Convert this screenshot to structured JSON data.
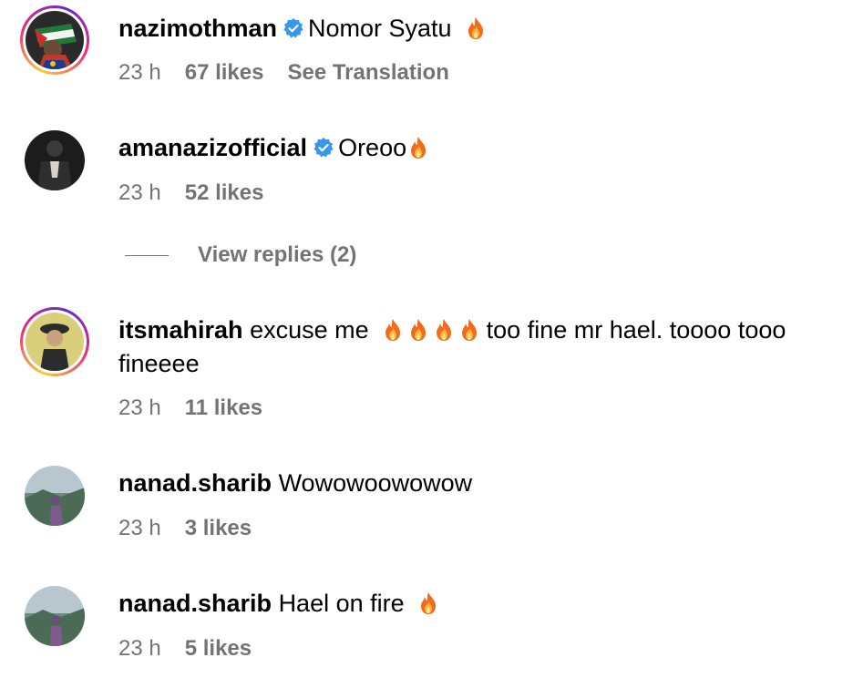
{
  "comments": [
    {
      "username": "nazimothman",
      "verified": true,
      "text": "Nomor Syatu",
      "fire_count": 1,
      "time": "23 h",
      "likes": "67 likes",
      "extra": "See Translation",
      "avatar_icon": "flag-profile-icon",
      "story_ring": true
    },
    {
      "username": "amanazizofficial",
      "verified": true,
      "text": "Oreoo",
      "fire_count": 1,
      "time": "23 h",
      "likes": "52 likes",
      "avatar_icon": "dark-portrait-icon",
      "story_ring": false
    },
    {
      "username": "itsmahirah",
      "verified": false,
      "text_before": "excuse me",
      "fire_count": 4,
      "text_after": "too fine mr hael. toooo tooo fineeee",
      "time": "23 h",
      "likes": "11 likes",
      "avatar_icon": "yellow-portrait-icon",
      "story_ring": true
    },
    {
      "username": "nanad.sharib",
      "verified": false,
      "text": "Wowowoowowow",
      "time": "23 h",
      "likes": "3 likes",
      "avatar_icon": "landscape-portrait-icon",
      "story_ring": false
    },
    {
      "username": "nanad.sharib",
      "verified": false,
      "text": "Hael on fire",
      "fire_count": 1,
      "time": "23 h",
      "likes": "5 likes",
      "avatar_icon": "landscape-portrait-icon",
      "story_ring": false
    }
  ],
  "view_replies": "View replies (2)",
  "colors": {
    "verified_blue": "#3797f0",
    "meta_gray": "#737373",
    "fire_orange": "#f5811f",
    "fire_red": "#e8431a"
  }
}
